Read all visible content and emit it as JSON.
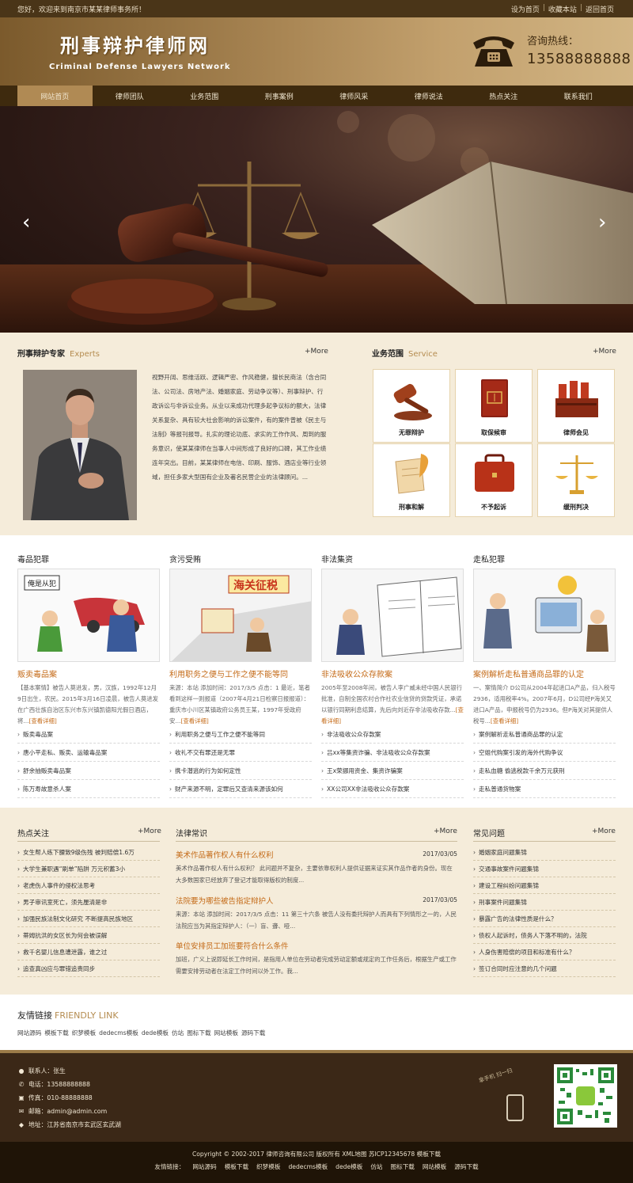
{
  "topbar": {
    "welcome": "您好，欢迎来到南京市某某律师事务所！",
    "links": [
      "设为首页",
      "收藏本站",
      "返回首页"
    ]
  },
  "header": {
    "logo_cn": "刑事辩护律师网",
    "logo_en": "Criminal Defense Lawyers Network",
    "hotline_label": "咨询热线：",
    "hotline_number": "13588888888"
  },
  "nav": [
    "网站首页",
    "律师团队",
    "业务范围",
    "刑事案例",
    "律师风采",
    "律师说法",
    "热点关注",
    "联系我们"
  ],
  "banner": {
    "prev": "‹",
    "next": "›"
  },
  "experts": {
    "title": "刑事辩护专家",
    "title_en": "Experts",
    "more": "+More",
    "text": "视野开阔、思维活跃、逻辑严密、作风稳健，擅长民商法（含合同法、公司法、房地产法、婚姻家庭、劳动争议等）、刑事辩护、行政诉讼与非诉讼业务。从业以来成功代理多起争议标的额大，法律关系复杂、具有较大社会影响的诉讼案件，有的案件曾被《民主与法制》等报刊报导。扎实的理论功底、求实的工作作风、周到的服务意识，使某某律师在当事人中间形成了良好的口碑，其工作业绩连年突出。目前，某某律师在电信、印刷、服饰、酒店业等行业领域，担任多家大型国有企业及著名民营企业的法律顾问。..."
  },
  "service": {
    "title": "业务范围",
    "title_en": "Service",
    "more": "+More",
    "items": [
      "无罪辩护",
      "取保候审",
      "律师会见",
      "刑事和解",
      "不予起诉",
      "缓刑判决"
    ]
  },
  "cases": [
    {
      "category": "毒品犯罪",
      "headline": "贩卖毒品案",
      "desc": "【基本案情】被告人莫进发，男，汉族，1992年12月9日出生，农民。2015年3月16日凌晨，被告人莫进发在广西壮族自治区东兴市东兴镇凯德阳光假日酒店，将...",
      "read_more": "[查看详细]",
      "list": [
        "贩卖毒品案",
        "唐小平走私、贩卖、运输毒品案",
        "舒余抽贩卖毒品案",
        "陈万寿故意杀人案"
      ]
    },
    {
      "category": "贪污受贿",
      "headline": "利用职务之便与工作之便不能等同",
      "desc": "来源：本站 添加时间：2017/3/5 点击：1 最近，笔者看到这样一则报道（2007年4月21日检察日报报道）：重庆市小川区某镇政府公务员王某，1997年受政府安...",
      "read_more": "[查看详细]",
      "list": [
        "利用职务之便与工作之便不能等同",
        "收礼不交有罪还是无罪",
        "携卡潜逃的行为如何定性",
        "财产来源不明，定罪后又查清来源该如何"
      ]
    },
    {
      "category": "非法集资",
      "headline": "非法吸收公众存款案",
      "desc": "2005年至2008年间，被告人李广威未经中国人民银行批准，自制全国农村合作社农业信贷的贷款凭证，承诺以银行同期利息结算，先后向刘近存非法吸收存款...",
      "read_more": "[查看详细]",
      "list": [
        "非法吸收公众存款案",
        "吕xx等集资诈骗、非法吸收公众存款案",
        "王x荣挪用资金、集资诈骗案",
        "XX公司XX非法吸收公众存款案"
      ]
    },
    {
      "category": "走私犯罪",
      "headline": "案例解析走私普通商品罪的认定",
      "desc": "一、案情简介 D公司从2004年起进口A产品，归入税号2936，适用税率4%。2007年6月，D公司经P海关又进口A产品，申报税号仍为2936。但P海关对其提供人税号...",
      "read_more": "[查看详细]",
      "list": [
        "案例解析走私普通商品罪的认定",
        "空姐代购案引发的海外代购争议",
        "走私血糖 偷逃税款千余万元获刑",
        "走私普通货物案"
      ]
    }
  ],
  "hot": {
    "title": "热点关注",
    "more": "+More",
    "items": [
      "女生帮人练下腰致9级伤残 被判赔偿1.6万",
      "大学生兼职遇“刷单”陷阱 万元积蓄3小",
      "老虎伤人事件的侵权法思考",
      "男子审讯室死亡，须先厘清是非",
      "加强民族法制文化研究 不断提高民族地区",
      "蒂姆抗洪的女区长为何会被误解",
      "救千名婴儿信息遭泄露，谁之过",
      "追查真凶应与罪错追责同步"
    ]
  },
  "law": {
    "title": "法律常识",
    "more": "+More",
    "articles": [
      {
        "title": "美术作品著作权人有什么权利",
        "date": "2017/03/05",
        "text": "美术作品著作权人有什么权利？ 此问题并不复杂，主要依靠权利人提供证据来证实其作品作者的身份。现在大多数国家已经放弃了登记才能取得版权的制度..."
      },
      {
        "title": "法院要为哪些被告指定辩护人",
        "date": "2017/03/05",
        "text": "来源：本站 添加时间：2017/3/5 点击：11 第三十六条 被告人没有委托辩护人而具有下列情形之一的，人民法院应当为其指定辩护人：（一）盲、聋、哑..."
      },
      {
        "title": "单位安排员工加班要符合什么条件",
        "date": "2017/03/05",
        "text": "加班，广义上说即延长工作时间，是指用人单位在劳动者完成劳动定额或规定的工作任务后，根据生产或工作需要安排劳动者在法定工作时间以外工作。我..."
      }
    ]
  },
  "faq": {
    "title": "常见问题",
    "more": "+More",
    "items": [
      "婚姻家庭问题集锦",
      "交通事故案件问题集锦",
      "建设工程纠纷问题集锦",
      "刑事案件问题集锦",
      "暴露广告的法律性质是什么？",
      "债权人起诉时，债务人下落不明的，法院",
      "人身伤害赔偿的项目和标准有什么？",
      "签订合同时应注意的几个问题"
    ]
  },
  "friendly": {
    "title": "友情链接",
    "title_en": "FRIENDLY LINK",
    "links": [
      "网站源码",
      "模板下载",
      "织梦模板",
      "dedecms模板",
      "dede模板",
      "仿站",
      "图标下载",
      "网站模板",
      "源码下载"
    ]
  },
  "contact": {
    "person": "联系人：张生",
    "phone": "电话：13588888888",
    "fax": "传真：010-88888888",
    "email": "邮箱：admin@admin.com",
    "address": "地址：江苏省南京市玄武区玄武湖",
    "mobile_text": "拿手机 扫一扫"
  },
  "bottom": {
    "copyright": "Copyright © 2002-2017 律师咨询有限公司 版权所有 XML地图 苏ICP12345678 模板下载",
    "links_label": "友情链接：",
    "links": [
      "网站源码",
      "模板下载",
      "织梦模板",
      "dedecms模板",
      "dede模板",
      "仿站",
      "图标下载",
      "网站模板",
      "源码下载"
    ]
  },
  "colors": {
    "brand_dark": "#3e2a0e",
    "accent_orange": "#c46a17",
    "gold": "#b08a54",
    "cream": "#f5ecda"
  }
}
